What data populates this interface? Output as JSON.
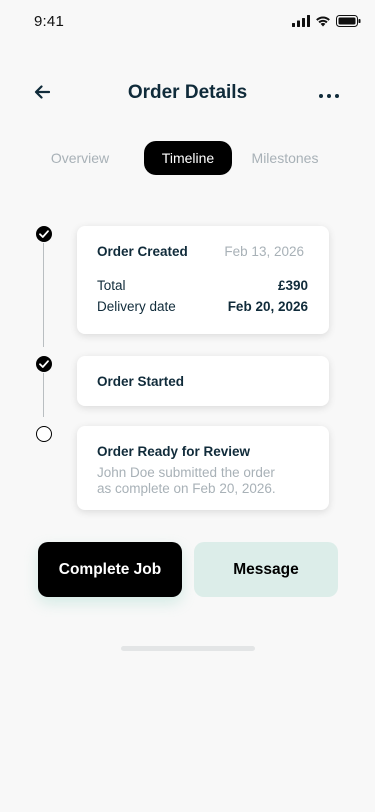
{
  "status_bar": {
    "time": "9:41",
    "icons": [
      "signal-icon",
      "wifi-icon",
      "battery-icon"
    ]
  },
  "header": {
    "title": "Order Details",
    "back_icon": "arrow-left-icon",
    "more_icon": "more-horizontal-icon"
  },
  "tabs": [
    {
      "label": "Overview",
      "active": false
    },
    {
      "label": "Timeline",
      "active": true
    },
    {
      "label": "Milestones",
      "active": false
    }
  ],
  "timeline": [
    {
      "title": "Order Created",
      "date": "Feb 13, 2026",
      "status": "done",
      "rows": [
        {
          "label": "Total",
          "value": "£390"
        },
        {
          "label": "Delivery date",
          "value": "Feb 20, 2026"
        }
      ]
    },
    {
      "title": "Order Started",
      "status": "done"
    },
    {
      "title": "Order Ready for Review",
      "status": "pending",
      "description_line1": "John Doe submitted the order",
      "description_line2": "as complete on Feb 20, 2026."
    }
  ],
  "actions": {
    "complete_label": "Complete Job",
    "message_label": "Message"
  },
  "colors": {
    "primary_text": "#102b3a",
    "muted_text": "#a8b1b7",
    "accent_black": "#000000",
    "message_bg": "#dcede9",
    "background": "#f8f8f8"
  }
}
